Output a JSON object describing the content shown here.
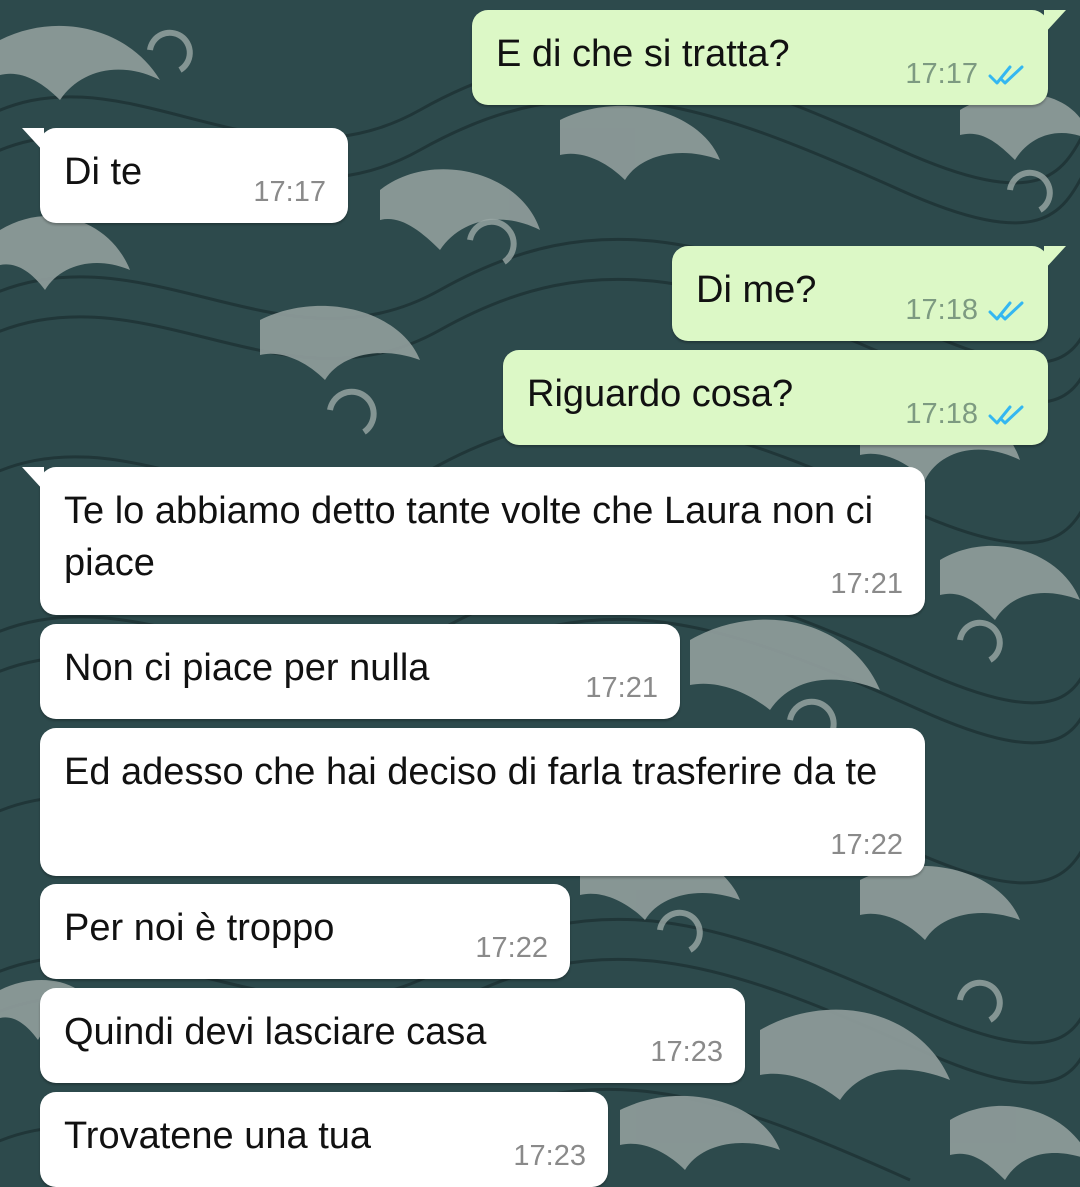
{
  "chat": {
    "messages": [
      {
        "direction": "out",
        "text": "E di che si tratta?",
        "time": "17:17",
        "status_icon": "double-check-icon"
      },
      {
        "direction": "in",
        "text": "Di te",
        "time": "17:17"
      },
      {
        "direction": "out",
        "text": "Di me?",
        "time": "17:18",
        "status_icon": "double-check-icon"
      },
      {
        "direction": "out",
        "text": "Riguardo cosa?",
        "time": "17:18",
        "status_icon": "double-check-icon"
      },
      {
        "direction": "in",
        "text": "Te lo abbiamo detto tante volte che Laura non ci piace",
        "time": "17:21"
      },
      {
        "direction": "in",
        "text": "Non ci piace per nulla",
        "time": "17:21"
      },
      {
        "direction": "in",
        "text": "Ed adesso che hai deciso di farla trasferire da te",
        "time": "17:22"
      },
      {
        "direction": "in",
        "text": "Per noi è troppo",
        "time": "17:22"
      },
      {
        "direction": "in",
        "text": "Quindi devi lasciare casa",
        "time": "17:23"
      },
      {
        "direction": "in",
        "text": "Trovatene una tua",
        "time": "17:23"
      }
    ]
  },
  "colors": {
    "outgoing_bubble": "#dcf8c6",
    "incoming_bubble": "#ffffff",
    "read_tick": "#34b7f1",
    "wallpaper_dark": "#2d4a4c",
    "wallpaper_wave": "#8c9a98"
  }
}
